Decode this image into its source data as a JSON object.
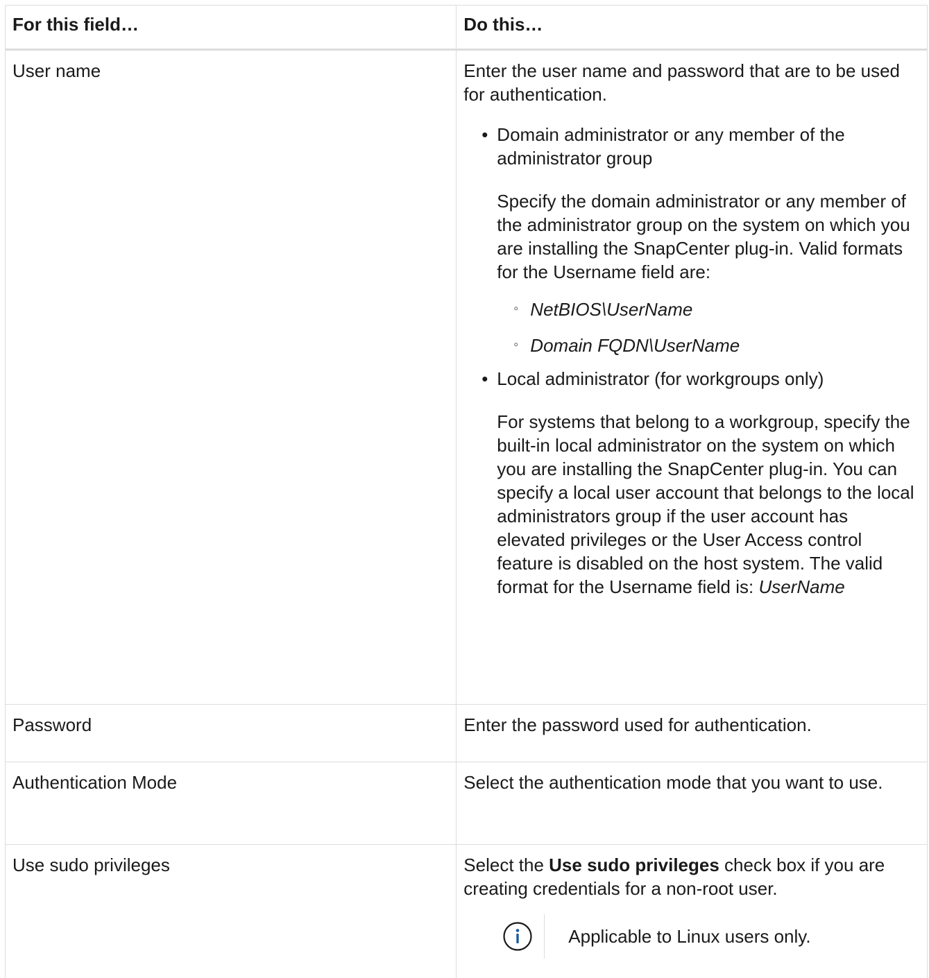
{
  "table": {
    "headers": {
      "field": "For this field…",
      "action": "Do this…"
    },
    "rows": {
      "username": {
        "field": "User name",
        "intro": "Enter the user name and password that are to be used for authentication.",
        "bullet1": {
          "title": "Domain administrator or any member of the administrator group",
          "body": "Specify the domain administrator or any member of the administrator group on the system on which you are installing the SnapCenter plug-in. Valid formats for the Username field are:",
          "formats": [
            "NetBIOS\\UserName",
            "Domain FQDN\\UserName"
          ]
        },
        "bullet2": {
          "title": "Local administrator (for workgroups only)",
          "body": "For systems that belong to a workgroup, specify the built-in local administrator on the system on which you are installing the SnapCenter plug-in. You can specify a local user account that belongs to the local administrators group if the user account has elevated privileges or the User Access control feature is disabled on the host system. The valid format for the Username field is:",
          "format": "UserName"
        }
      },
      "password": {
        "field": "Password",
        "action": "Enter the password used for authentication."
      },
      "authmode": {
        "field": "Authentication Mode",
        "action": "Select the authentication mode that you want to use."
      },
      "sudo": {
        "field": "Use sudo privileges",
        "action_prefix": "Select the ",
        "action_bold": "Use sudo privileges",
        "action_suffix": " check box if you are creating credentials for a non-root user.",
        "note_icon": "info-icon",
        "note": "Applicable to Linux users only."
      }
    }
  },
  "colors": {
    "border": "#dcdcdc",
    "info_icon": "#1a5a9e",
    "text": "#1a1a1a"
  }
}
